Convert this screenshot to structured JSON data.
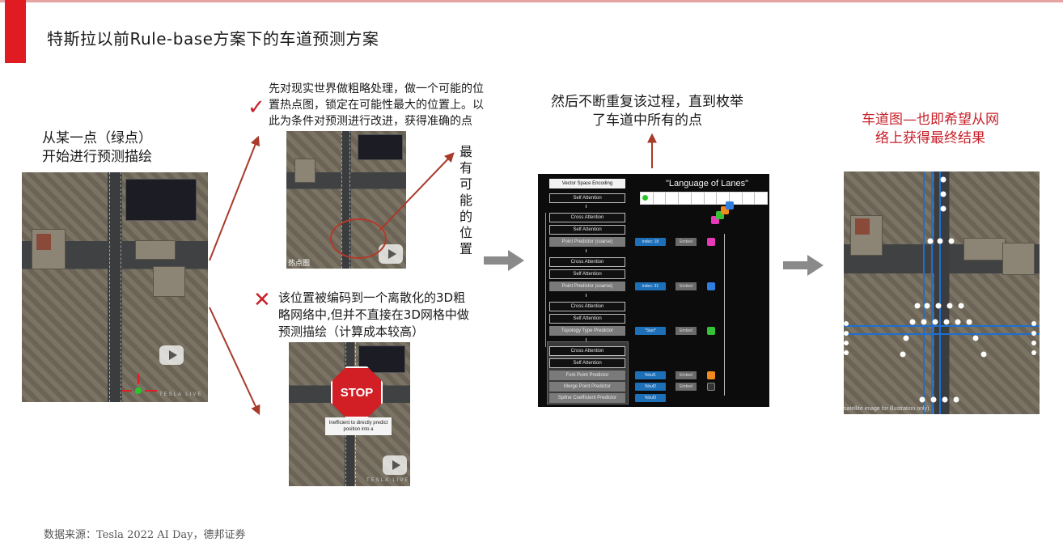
{
  "title": "特斯拉以前Rule-base方案下的车道预测方案",
  "captions": {
    "start": [
      "从某一点（绿点）",
      "开始进行预测描绘"
    ],
    "heatmap": [
      "先对现实世界做粗略处理，做一个可能的位",
      "置热点图，锁定在可能性最大的位置上。以",
      "此为条件对预测进行改进，获得准确的点"
    ],
    "most_likely": "最有可能的位置",
    "rejected": [
      "该位置被编码到一个离散化的3D粗",
      "略网络中,但并不直接在3D网格中做",
      "预测描绘（计算成本较高）"
    ],
    "repeat": [
      "然后不断重复该过程，直到枚举",
      "了车道中所有的点"
    ],
    "result": [
      "车道图—也即希望从网",
      "络上获得最终结果"
    ]
  },
  "marks": {
    "check": "✓",
    "cross": "✕"
  },
  "image_labels": {
    "heatmap_label": "热点图",
    "stop": "STOP",
    "stop_note": "Inefficient to directly predict position into a",
    "tesla_live": "TESLA LIVE",
    "satellite_note": "satellite image for illustration only)"
  },
  "diagram": {
    "title": "\"Language of Lanes\"",
    "boxes": [
      {
        "label": "Vector Space Encoding",
        "style": "hd"
      },
      {
        "label": "Self Attention",
        "style": ""
      },
      {
        "label": "Cross Attention",
        "style": ""
      },
      {
        "label": "Self Attention",
        "style": ""
      },
      {
        "label": "Point Predictor (coarse)",
        "style": "gray"
      },
      {
        "label": "Cross Attention",
        "style": ""
      },
      {
        "label": "Self Attention",
        "style": ""
      },
      {
        "label": "Point Predictor (coarse)",
        "style": "gray"
      },
      {
        "label": "Cross Attention",
        "style": ""
      },
      {
        "label": "Self Attention",
        "style": ""
      },
      {
        "label": "Topology Type Predictor",
        "style": "gray"
      },
      {
        "label": "Cross Attention",
        "style": ""
      },
      {
        "label": "Self Attention",
        "style": ""
      },
      {
        "label": "Fork Point Predictor",
        "style": "gray"
      },
      {
        "label": "Merge Point Predictor",
        "style": "gray"
      },
      {
        "label": "Spline Coefficient Predictor",
        "style": "gray"
      }
    ],
    "outputs": [
      {
        "token": "index: 18",
        "embed": "Embed",
        "color": "#e83ab8"
      },
      {
        "token": "index: 31",
        "embed": "Embed",
        "color": "#2f7fe0"
      },
      {
        "token": "\"Start\"",
        "embed": "Embed",
        "color": "#36c236"
      },
      {
        "token": "%buf1",
        "embed": "Embed",
        "color": "#f08a1c"
      },
      {
        "token": "%buf2",
        "embed": "Embed",
        "color": "#333333"
      },
      {
        "token": "%buf3",
        "embed": "",
        "color": ""
      }
    ]
  },
  "footer": "数据来源：Tesla 2022 AI Day，德邦证券"
}
